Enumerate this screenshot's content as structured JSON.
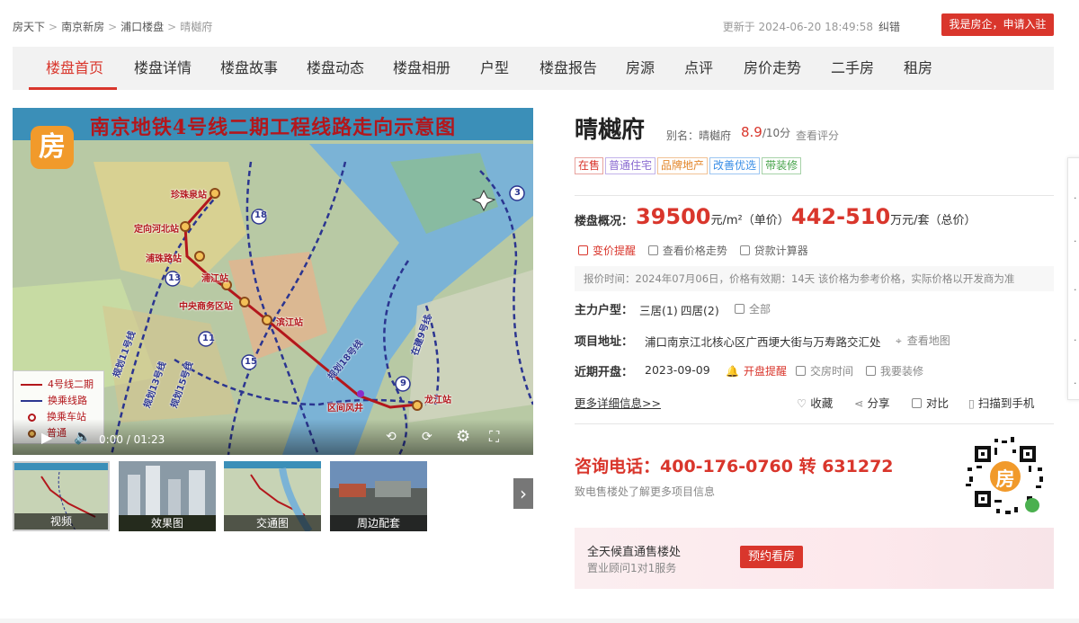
{
  "breadcrumb": {
    "items": [
      "房天下",
      "南京新房",
      "浦口楼盘"
    ],
    "current": "晴樾府"
  },
  "header": {
    "updated": "更新于 2024-06-20 18:49:58",
    "report_error": "纠错",
    "join_button": "我是房企，申请入驻"
  },
  "nav": {
    "tabs": [
      "楼盘首页",
      "楼盘详情",
      "楼盘故事",
      "楼盘动态",
      "楼盘相册",
      "户型",
      "楼盘报告",
      "房源",
      "点评",
      "房价走势",
      "二手房",
      "租房"
    ],
    "active_index": 0
  },
  "media": {
    "map_title": "南京地铁4号线二期工程线路走向示意图",
    "logo_char": "房",
    "legend": [
      "4号线二期",
      "换乘线路",
      "换乘车站",
      "普通"
    ],
    "stations": [
      "珍珠泉站",
      "定向河北站",
      "浦珠路站",
      "浦江站",
      "中央商务区站",
      "滨江站",
      "区间风井",
      "龙江站"
    ],
    "line_numbers": [
      "18",
      "13",
      "11",
      "15",
      "9",
      "3"
    ],
    "line_labels": [
      "规划18号线",
      "规划11号线",
      "规划15号线",
      "规划13号线",
      "在建9号线"
    ],
    "current_time": "0:00",
    "duration": "01:23",
    "time_separator": "/",
    "thumbnails": [
      "视频",
      "效果图",
      "交通图",
      "周边配套"
    ]
  },
  "project": {
    "name": "晴樾府",
    "alias_label": "别名：",
    "alias": "晴樾府",
    "score": "8.9",
    "score_max": "/10分",
    "see_score": "查看评分",
    "tags": [
      {
        "text": "在售",
        "color": "#d9362c"
      },
      {
        "text": "普通住宅",
        "color": "#8a6bd1"
      },
      {
        "text": "品牌地产",
        "color": "#e3862b"
      },
      {
        "text": "改善优选",
        "color": "#3a8ee6"
      },
      {
        "text": "带装修",
        "color": "#46a34a"
      }
    ]
  },
  "price": {
    "label": "楼盘概况：",
    "unit_price": "39500",
    "unit_price_unit": "元/m²（单价）",
    "total_price": "442-510",
    "total_price_unit": "万元/套（总价）",
    "tools": [
      "变价提醒",
      "查看价格走势",
      "贷款计算器"
    ],
    "note": "报价时间：2024年07月06日，价格有效期：14天  该价格为参考价格，实际价格以开发商为准"
  },
  "details": {
    "layout_label": "主力户型：",
    "layouts": [
      "三居(1)",
      "四居(2)"
    ],
    "layout_all": "全部",
    "address_label": "项目地址：",
    "address": "浦口南京江北核心区广西埂大街与万寿路交汇处",
    "view_map": "查看地图",
    "opening_label": "近期开盘：",
    "opening_date": "2023-09-09",
    "opening_links": [
      "开盘提醒",
      "交房时间",
      "我要装修"
    ]
  },
  "actions": {
    "more_info": "更多详细信息>>",
    "items": [
      "收藏",
      "分享",
      "对比",
      "扫描到手机"
    ]
  },
  "contact": {
    "phone": "咨询电话：400-176-0760 转 631272",
    "subtext": "致电售楼处了解更多项目信息",
    "qr_logo_char": "房"
  },
  "banner": {
    "title": "全天候直通售楼处",
    "subtitle": "置业顾问1对1服务",
    "button": "预约看房"
  },
  "colors": {
    "accent": "#d9362c",
    "nav_bg": "#f2f2f2",
    "logo_orange": "#f19a2b"
  }
}
